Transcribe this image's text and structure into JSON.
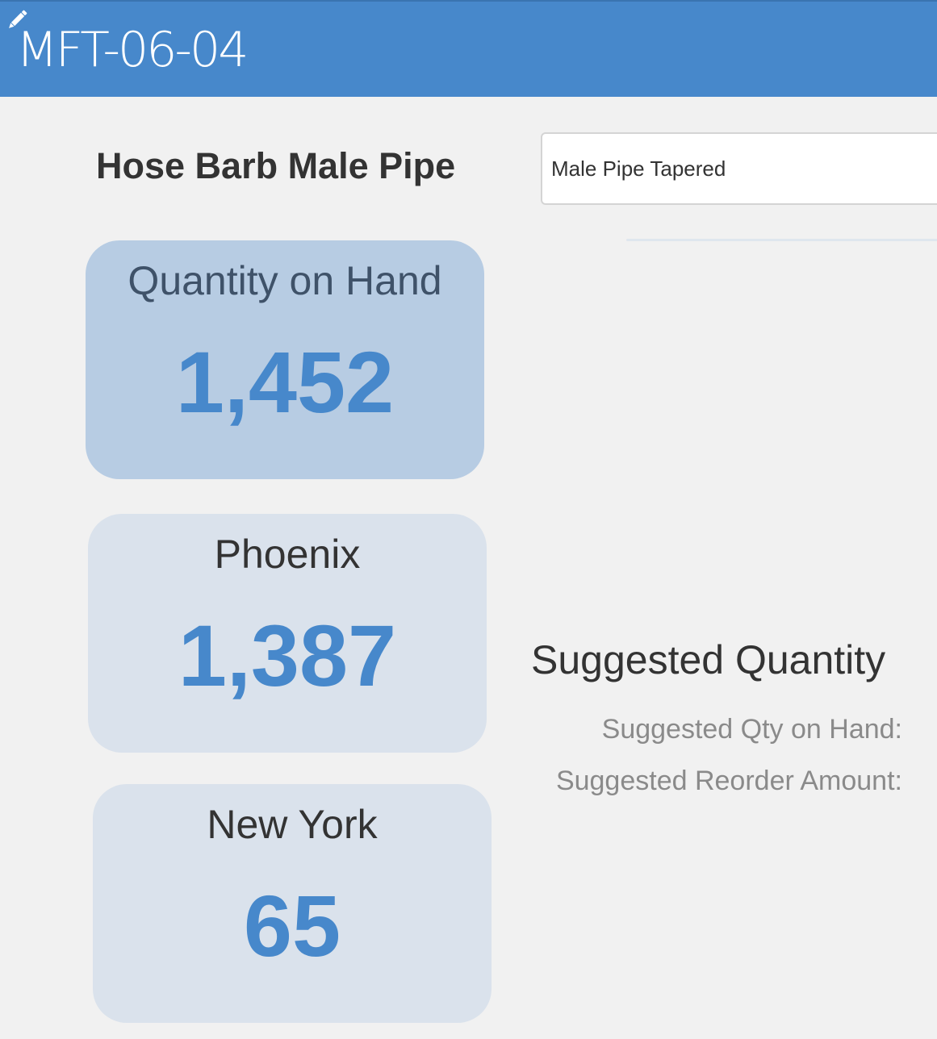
{
  "header": {
    "record_id": "MFT-06-04",
    "edit_icon": "pencil-icon"
  },
  "product": {
    "name": "Hose Barb Male Pipe",
    "description_value": "Male Pipe Tapered"
  },
  "tiles": {
    "quantity_on_hand": {
      "label": "Quantity on Hand",
      "value": "1,452"
    },
    "phoenix": {
      "label": "Phoenix",
      "value": "1,387"
    },
    "new_york": {
      "label": "New York",
      "value": "65"
    }
  },
  "suggested": {
    "heading": "Suggested Quantity",
    "qty_on_hand_label": "Suggested Qty on Hand:",
    "reorder_amount_label": "Suggested Reorder Amount:"
  },
  "colors": {
    "header_bg": "#4788cb",
    "accent": "#4788cb",
    "primary_tile_bg": "#b7cce3",
    "tile_bg": "#dae2ec",
    "page_bg": "#f1f1f1"
  }
}
